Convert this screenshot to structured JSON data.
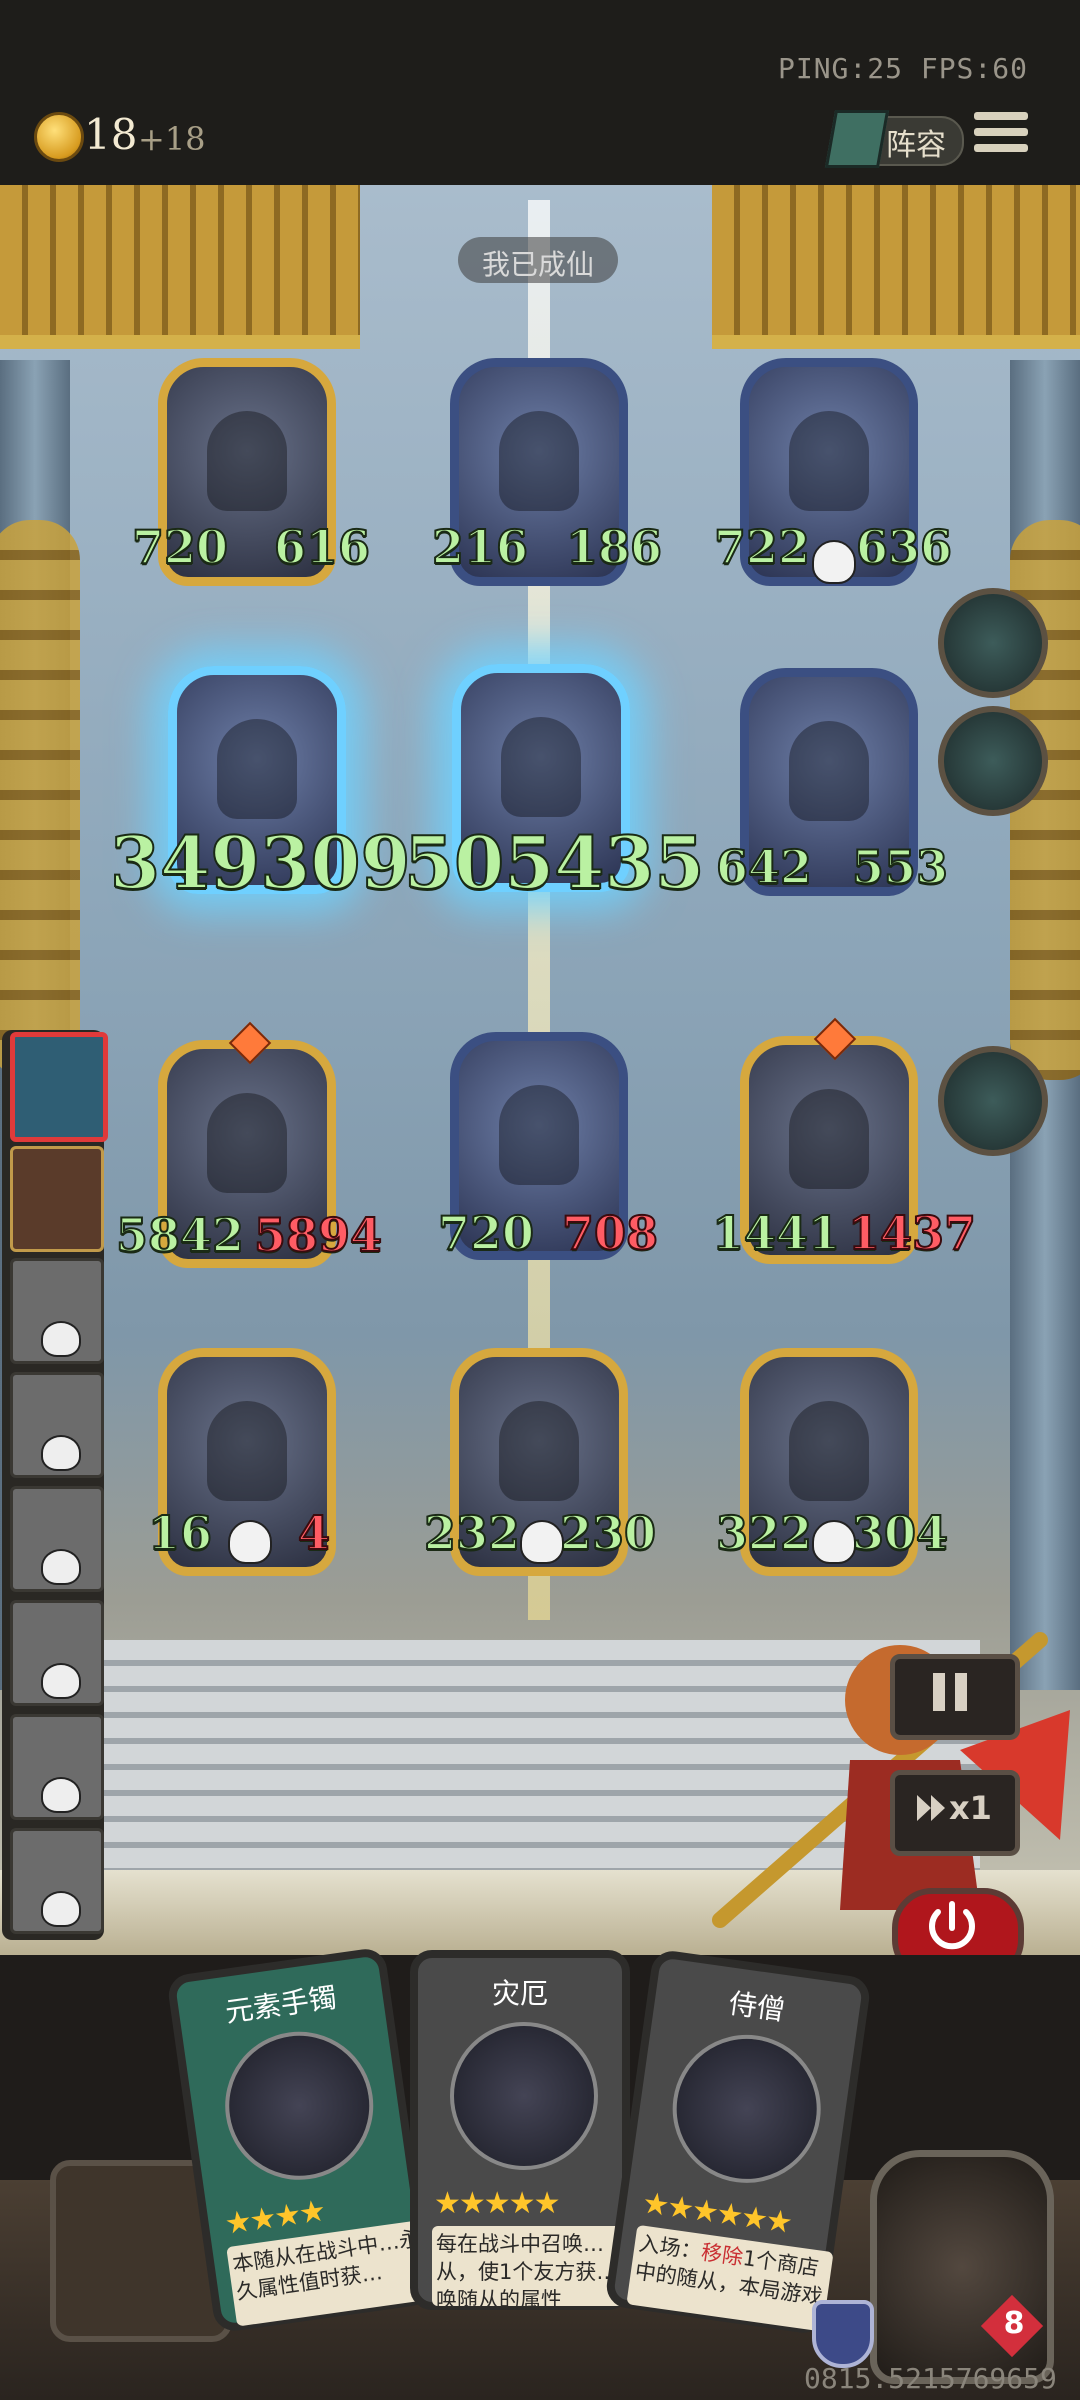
{
  "hud": {
    "network": "PING:25   FPS:60",
    "gold": "18",
    "gold_income": "+18",
    "lineup_label": "阵容",
    "board_title": "我已成仙"
  },
  "board": {
    "units": [
      {
        "atk": "720",
        "hp": "616"
      },
      {
        "atk": "216",
        "hp": "186"
      },
      {
        "atk": "722",
        "hp": "636"
      },
      {
        "atk": "349309",
        "hp": ""
      },
      {
        "atk": "505435",
        "hp": ""
      },
      {
        "atk": "642",
        "hp": "553"
      },
      {
        "atk": "5842",
        "hp": "5894"
      },
      {
        "atk": "720",
        "hp": "708"
      },
      {
        "atk": "1441",
        "hp": "1437"
      },
      {
        "atk": "16",
        "hp": "4"
      },
      {
        "atk": "232",
        "hp": "230"
      },
      {
        "atk": "322",
        "hp": "304"
      }
    ]
  },
  "controls": {
    "speed_label": "x1"
  },
  "hand": [
    {
      "title": "元素手镯",
      "stars": "★★★★",
      "desc": "本随从在战斗中…永久属性值时获…"
    },
    {
      "title": "灾厄",
      "stars": "★★★★★",
      "desc": "每在战斗中召唤…从，使1个友方获…唤随从的属性"
    },
    {
      "title": "侍僧",
      "stars": "★★★★★★",
      "desc_prefix": "入场：",
      "desc_hl": "移除",
      "desc_rest": "1个商店中的随从，本局游戏"
    }
  ],
  "player": {
    "health": "8",
    "seed": "0815.5215769659"
  },
  "icons": [
    "coin-icon",
    "lineup-icon",
    "menu-icon",
    "skull-icon",
    "pause-icon",
    "fast-forward-icon",
    "power-icon",
    "shield-icon",
    "heart-icon"
  ]
}
